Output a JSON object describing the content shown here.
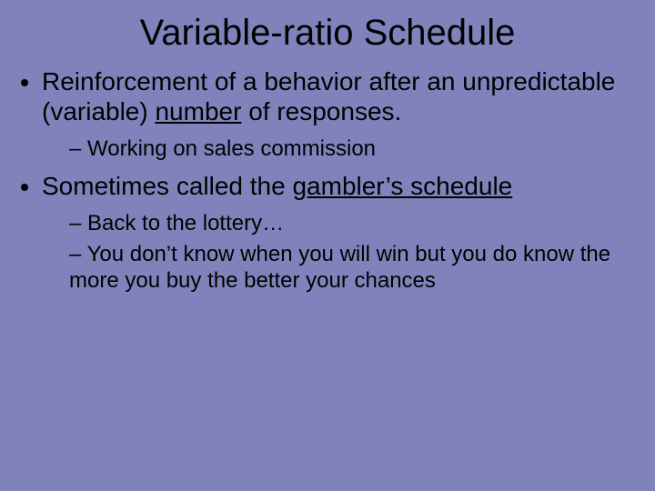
{
  "title": "Variable-ratio Schedule",
  "bullets": {
    "b1_pre": "Reinforcement of a behavior after an unpredictable (variable) ",
    "b1_u": "number",
    "b1_post": " of responses.",
    "b1_sub1": "Working on sales commission",
    "b2_pre": "Sometimes called the ",
    "b2_u": "gambler’s schedule",
    "b2_sub1": "Back to the lottery…",
    "b2_sub2": "You don’t know when you will win but you do know the more you buy the better your chances"
  }
}
